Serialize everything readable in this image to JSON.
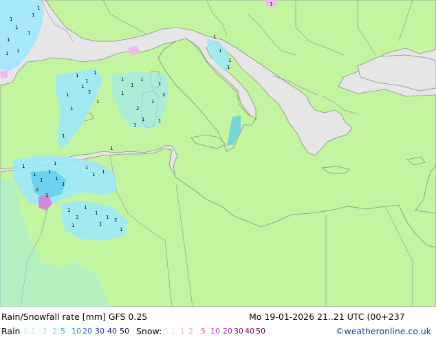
{
  "map": {
    "colors": {
      "sea": "#e6e6e6",
      "land": "#c3f5a0",
      "border": "#9a9a9a",
      "coast": "#8c8c8c",
      "rain_light": "#9be8ff",
      "rain_mid": "#55c8f0",
      "snow_light": "#f2b8f2",
      "snow_mid": "#e070e0"
    },
    "legend_colors": [
      "#b4f0ff",
      "#8ce6ff",
      "#5ad2f5",
      "#28b4e6",
      "#1e90dc",
      "#1e64c8",
      "#1e32a0",
      "#14147d",
      "#0a0a50"
    ],
    "snow_colors": [
      "#fadcfa",
      "#f0b4f0",
      "#e68ce6",
      "#d264d2",
      "#be3cbe",
      "#a01ea0",
      "#820a82",
      "#640064",
      "#460046"
    ]
  },
  "footer": {
    "title": "Rain/Snowfall rate [mm]  GFS 0.25",
    "datetime": "Mo 19-01-2026 21..21 UTC (00+237",
    "rain_label": "Rain",
    "rain_values": [
      "0.1",
      "1",
      "2",
      "5",
      "10",
      "20",
      "30",
      "40",
      "50"
    ],
    "snow_label": "Snow:",
    "snow_values": [
      "0.1",
      "1",
      "2",
      "5",
      "10",
      "20",
      "30",
      "40",
      "50"
    ],
    "credit": "©weatheronline.co.uk"
  }
}
